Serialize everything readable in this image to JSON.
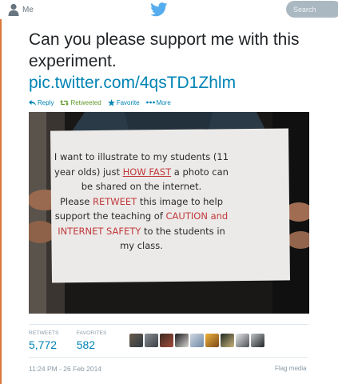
{
  "nav": {
    "me_label": "Me",
    "search_placeholder": "Search",
    "icons": [
      "person-icon",
      "twitter-bird-icon"
    ],
    "brand_color": "#55acee"
  },
  "tweet": {
    "text": "Can you please support me with this experiment.",
    "link": "pic.twitter.com/4qsTD1Zhlm"
  },
  "actions": [
    {
      "label": "Reply",
      "icon": "reply-icon"
    },
    {
      "label": "Retweeted",
      "icon": "retweet-icon"
    },
    {
      "label": "Favorite",
      "icon": "star-icon"
    },
    {
      "label": "More",
      "icon": "more-dots-icon"
    }
  ],
  "photo": {
    "line1": "I want to illustrate to my students (11",
    "line2_a": "year olds) just ",
    "line2_b": "HOW FAST",
    "line2_c": " a photo can",
    "line3": "be shared on the internet.",
    "line4_a": "Please ",
    "line4_b": "RETWEET",
    "line4_c": " this image to help",
    "line5_a": "support the teaching of ",
    "line5_b": "CAUTION and",
    "line6_a": "INTERNET SAFETY",
    "line6_b": " to the students in",
    "line7": "my class."
  },
  "stats": {
    "retweets_label": "RETWEETS",
    "retweets_value": "5,772",
    "favorites_label": "FAVORITES",
    "favorites_value": "582"
  },
  "meta": {
    "timestamp": "11:24 PM - 26 Feb 2014",
    "flag": "Flag media"
  },
  "colors": {
    "link": "#0084b4",
    "retweeted": "#609928",
    "muted": "#8899a6",
    "red_ink": "#c0393b"
  }
}
